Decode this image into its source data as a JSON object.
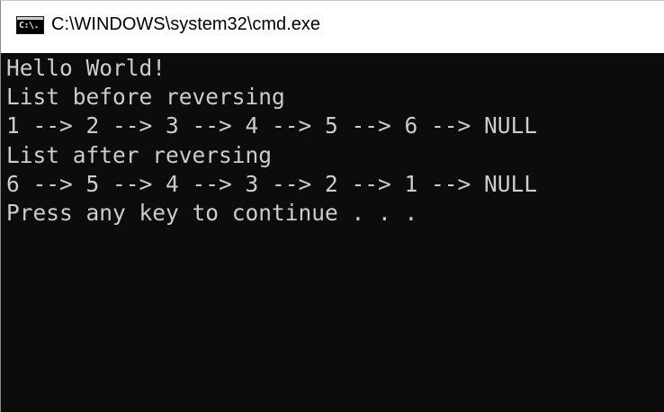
{
  "window": {
    "title": "C:\\WINDOWS\\system32\\cmd.exe",
    "icon": "cmd-console-icon",
    "icon_label": "C:\\."
  },
  "console": {
    "lines": [
      "Hello World!",
      "List before reversing",
      "1 --> 2 --> 3 --> 4 --> 5 --> 6 --> NULL",
      "List after reversing",
      "6 --> 5 --> 4 --> 3 --> 2 --> 1 --> NULL",
      "Press any key to continue . . ."
    ]
  },
  "colors": {
    "console_bg": "#0c0c0c",
    "console_text": "#cccccc",
    "titlebar_bg": "#ffffff"
  }
}
